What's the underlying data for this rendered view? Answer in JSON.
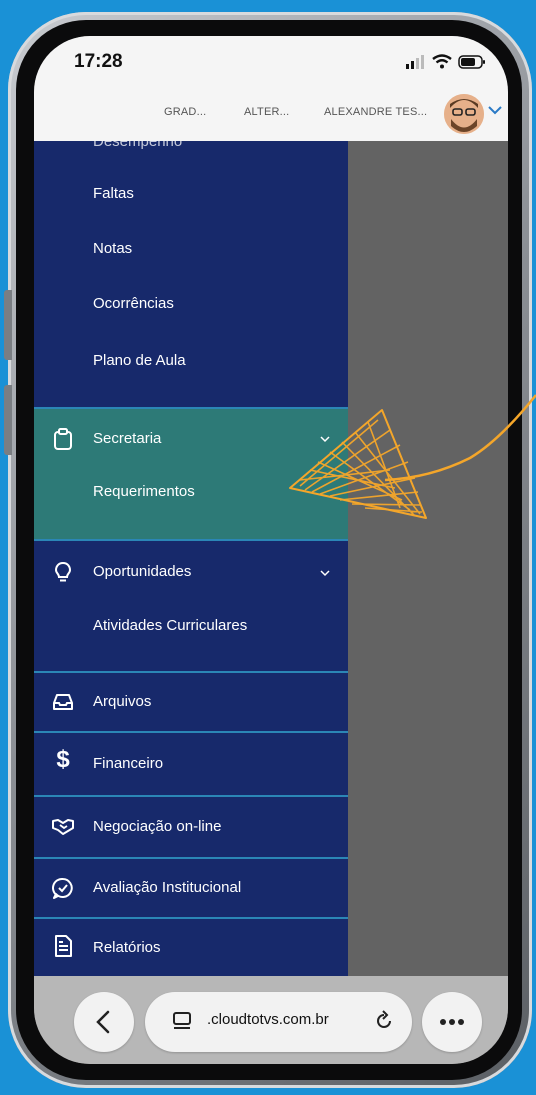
{
  "status": {
    "time": "17:28"
  },
  "header": {
    "item1": "GRAD...",
    "item2": "ALTER...",
    "user": "ALEXANDRE TES..."
  },
  "menu": {
    "partial_top": "Desempenho",
    "faltas": "Faltas",
    "notas": "Notas",
    "ocorrencias": "Ocorrências",
    "plano": "Plano de Aula",
    "secretaria": "Secretaria",
    "requerimentos": "Requerimentos",
    "oportunidades": "Oportunidades",
    "atividades": "Atividades Curriculares",
    "arquivos": "Arquivos",
    "financeiro": "Financeiro",
    "negociacao": "Negociação on-line",
    "avaliacao": "Avaliação Institucional",
    "relatorios": "Relatórios"
  },
  "browser": {
    "url": ".cloudtotvs.com.br"
  },
  "icons": {
    "secretaria": "clipboard-icon",
    "oportunidades": "lightbulb-icon",
    "arquivos": "inbox-icon",
    "financeiro": "dollar-icon",
    "negociacao": "handshake-icon",
    "avaliacao": "chat-check-icon",
    "relatorios": "document-icon"
  },
  "colors": {
    "menu_bg": "#17296b",
    "selected_bg": "#2d7a77",
    "divider": "#2b86b6",
    "annotation": "#f4a62a",
    "background": "#1a91d6"
  }
}
